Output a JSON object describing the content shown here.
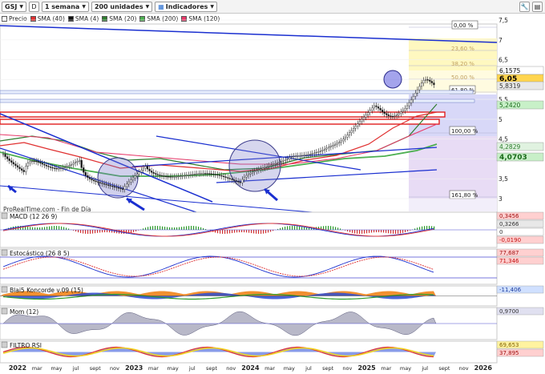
{
  "toolbar": {
    "symbol": "GSJ",
    "d_label": "D",
    "timeframe": "1 semana",
    "units": "200 unidades",
    "indicators": "Indicadores"
  },
  "legend": [
    {
      "label": "Precio",
      "color": "#ffffff"
    },
    {
      "label": "SMA (40)",
      "color": "#e03030"
    },
    {
      "label": "SMA (4)",
      "color": "#111111"
    },
    {
      "label": "SMA (20)",
      "color": "#2e7d2e"
    },
    {
      "label": "SMA (200)",
      "color": "#4caf50"
    },
    {
      "label": "SMA (120)",
      "color": "#e83a6a"
    }
  ],
  "watermark": "ProRealTime.com - Fin de Día",
  "price_axis": {
    "ticks": [
      "7,5",
      "7",
      "6,5",
      "6",
      "5,5",
      "5",
      "4,5",
      "4",
      "3,5",
      "3"
    ],
    "badges": [
      {
        "text": "6,1575",
        "bg": "#ffffff",
        "fg": "#000000",
        "bold": false
      },
      {
        "text": "6,05",
        "bg": "#ffd54f",
        "fg": "#000000",
        "bold": true
      },
      {
        "text": "5,8319",
        "bg": "#e8e8e8",
        "fg": "#333333",
        "bold": false
      },
      {
        "text": "5,2420",
        "bg": "#c8f0c8",
        "fg": "#1a6a1a",
        "bold": false
      },
      {
        "text": "4,2829",
        "bg": "#e0f2e0",
        "fg": "#2a7a2a",
        "bold": false
      },
      {
        "text": "4,0703",
        "bg": "#c8efc8",
        "fg": "#1a6a1a",
        "bold": true
      }
    ]
  },
  "fibonacci": [
    "0,00 %",
    "23,60 %",
    "38,20 %",
    "50,00 %",
    "61,80 %",
    "100,00 %",
    "161,80 %"
  ],
  "panels": [
    {
      "title": "MACD (12 26 9)",
      "values": [
        {
          "text": "0,3456",
          "bg": "#ffd0d0",
          "fg": "#a01010"
        },
        {
          "text": "0,3266",
          "bg": "#e8e8e8",
          "fg": "#333333"
        },
        {
          "text": "0",
          "bg": "#ffffff",
          "fg": "#333333"
        },
        {
          "text": "-0,0190",
          "bg": "#ffd0d0",
          "fg": "#c01010"
        }
      ]
    },
    {
      "title": "Estocástico (26 8 5)",
      "values": [
        {
          "text": "77,687",
          "bg": "#ffd0d0",
          "fg": "#a01010"
        },
        {
          "text": "71,346",
          "bg": "#ffd0d0",
          "fg": "#c01010"
        }
      ]
    },
    {
      "title": "Blai5 Koncorde v.09 (15)",
      "values": [
        {
          "text": "-11,406",
          "bg": "#d0e0ff",
          "fg": "#1a3a9a"
        }
      ]
    },
    {
      "title": "Mom (12)",
      "values": [
        {
          "text": "0,9700",
          "bg": "#e0e0f0",
          "fg": "#333333"
        }
      ]
    },
    {
      "title": "FILTRO RSI",
      "values": [
        {
          "text": "69,653",
          "bg": "#fff3a0",
          "fg": "#806000"
        },
        {
          "text": "37,895",
          "bg": "#ffd0d0",
          "fg": "#a01010"
        }
      ]
    }
  ],
  "time_axis": [
    "2022",
    "mar",
    "may",
    "jul",
    "sept",
    "nov",
    "2023",
    "mar",
    "may",
    "jul",
    "sept",
    "nov",
    "2024",
    "mar",
    "may",
    "jul",
    "sept",
    "nov",
    "2025",
    "mar",
    "may",
    "jul",
    "sept",
    "nov",
    "2026"
  ],
  "colors": {
    "trendline": "#1a2fd0",
    "support_box": "#e02020",
    "fib_upper": "#fff8c0",
    "fib_lower": "#e8dcf5",
    "fib_mid": "#d8d8f8",
    "up_candle": "#ffffff",
    "down_candle": "#111111"
  }
}
